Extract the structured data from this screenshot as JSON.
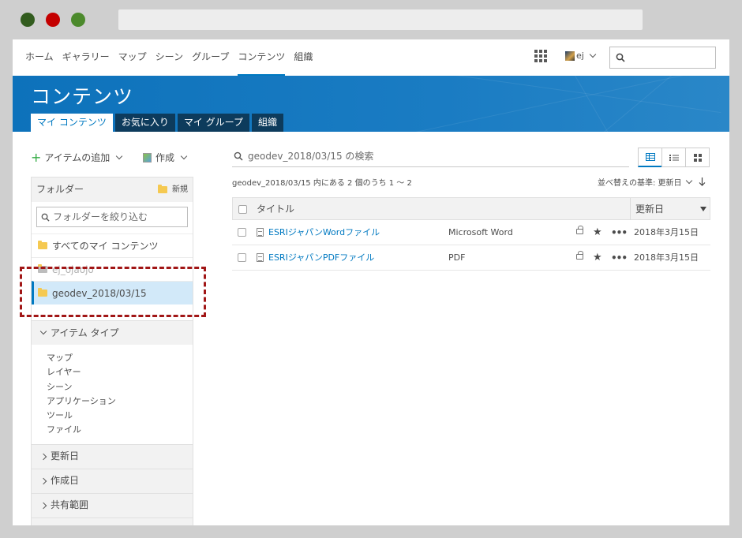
{
  "window": {
    "dot_colors": [
      "#325c1e",
      "#c40000",
      "#4c8a2c"
    ]
  },
  "nav": {
    "links": [
      "ホーム",
      "ギャラリー",
      "マップ",
      "シーン",
      "グループ",
      "コンテンツ",
      "組織"
    ],
    "active": "コンテンツ",
    "user": "ej"
  },
  "banner": {
    "title": "コンテンツ",
    "tabs": [
      "マイ コンテンツ",
      "お気に入り",
      "マイ グループ",
      "組織"
    ],
    "active_tab": "マイ コンテンツ",
    "color": "#0d72bb"
  },
  "left": {
    "add_item": "アイテムの追加",
    "create": "作成",
    "folders": {
      "heading": "フォルダー",
      "new": "新規",
      "filter_placeholder": "フォルダーを絞り込む",
      "items": [
        "すべてのマイ コンテンツ",
        "ej_ojaojo",
        "geodev_2018/03/15"
      ],
      "selected": "geodev_2018/03/15"
    },
    "item_type": {
      "heading": "アイテム タイプ",
      "items": [
        "マップ",
        "レイヤー",
        "シーン",
        "アプリケーション",
        "ツール",
        "ファイル"
      ]
    },
    "sections": [
      "更新日",
      "作成日",
      "共有範囲"
    ]
  },
  "main": {
    "search_placeholder": "geodev_2018/03/15 の検索",
    "count_text": "geodev_2018/03/15 内にある 2 個のうち 1 ～ 2",
    "sort_text": "並べ替えの基準: 更新日",
    "columns": {
      "title": "タイトル",
      "modified": "更新日"
    },
    "rows": [
      {
        "title": "ESRIジャパンWordファイル",
        "type": "Microsoft Word",
        "modified": "2018年3月15日"
      },
      {
        "title": "ESRIジャパンPDFファイル",
        "type": "PDF",
        "modified": "2018年3月15日"
      }
    ],
    "row_more": "•••",
    "row_star": "★"
  }
}
